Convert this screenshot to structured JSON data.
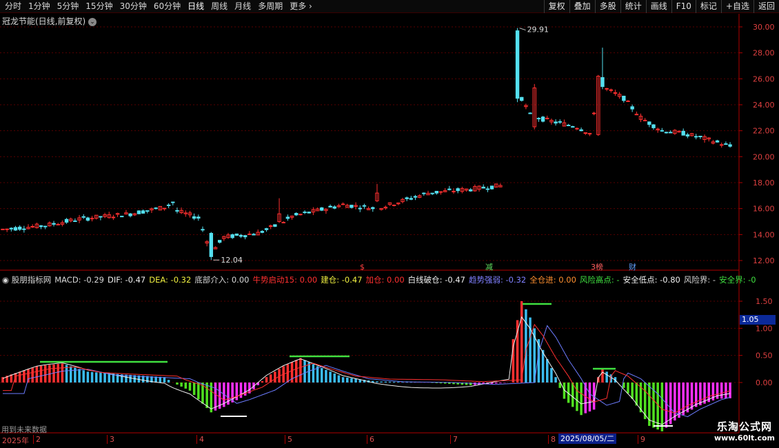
{
  "toolbar": {
    "periods": [
      "分时",
      "1分钟",
      "5分钟",
      "15分钟",
      "30分钟",
      "60分钟",
      "日线",
      "周线",
      "月线",
      "多周期",
      "更多"
    ],
    "active": "日线",
    "right_buttons": [
      "复权",
      "叠加",
      "多股",
      "统计",
      "画线",
      "F10",
      "标记",
      "+自选",
      "返回"
    ]
  },
  "price_panel": {
    "title": "冠龙节能(日线,前复权)",
    "high_label": "29.91",
    "low_label": "12.04",
    "y_ticks": [
      "30.00",
      "28.00",
      "26.00",
      "24.00",
      "22.00",
      "20.00",
      "18.00",
      "16.00",
      "14.00",
      "12.00"
    ],
    "event_marks": [
      {
        "text": "$",
        "color": "#ff4040"
      },
      {
        "text": "减",
        "color": "#60e060"
      },
      {
        "text": "3榜",
        "color": "#ff6060"
      },
      {
        "text": "财",
        "color": "#60a0ff"
      }
    ]
  },
  "indicator": {
    "name": "股朋指标网",
    "items": [
      {
        "text": "MACD: -0.29",
        "color": "#d8d8d8"
      },
      {
        "text": "DIF: -0.47",
        "color": "#f0f0f0"
      },
      {
        "text": "DEA: -0.32",
        "color": "#f0f040"
      },
      {
        "text": "底部介入: 0.00",
        "color": "#d8d8d8"
      },
      {
        "text": "牛势启动15: 0.00",
        "color": "#ff3030"
      },
      {
        "text": "建仓: -0.47",
        "color": "#f0f040"
      },
      {
        "text": "加仓: 0.00",
        "color": "#ff3030"
      },
      {
        "text": "白线破仓: -0.47",
        "color": "#f0f0f0"
      },
      {
        "text": "趋势强弱: -0.32",
        "color": "#8080ff"
      },
      {
        "text": "全仓进: 0.00",
        "color": "#ff9030"
      },
      {
        "text": "风险高点: -",
        "color": "#40e040"
      },
      {
        "text": "安全低点: -0.80",
        "color": "#f0f0f0"
      },
      {
        "text": "风险界: -",
        "color": "#d8d8d8"
      },
      {
        "text": "安全界: -0",
        "color": "#40e040"
      }
    ],
    "y_ticks": [
      "1.50",
      "1.00",
      "0.50",
      "0.00"
    ],
    "cursor_value": "1.05",
    "future_note": "用到未来数据"
  },
  "timeline": {
    "year": "2025年",
    "months": [
      "2",
      "3",
      "4",
      "5",
      "6",
      "7",
      "8",
      "9"
    ],
    "selected_date": "2025/08/05/二"
  },
  "watermark": {
    "line1": "乐淘公式网",
    "line2": "www.60lt.com"
  },
  "colors": {
    "up": "#ff3030",
    "down": "#54e0f0",
    "axis": "#b00000",
    "grid": "#5a0000"
  }
}
